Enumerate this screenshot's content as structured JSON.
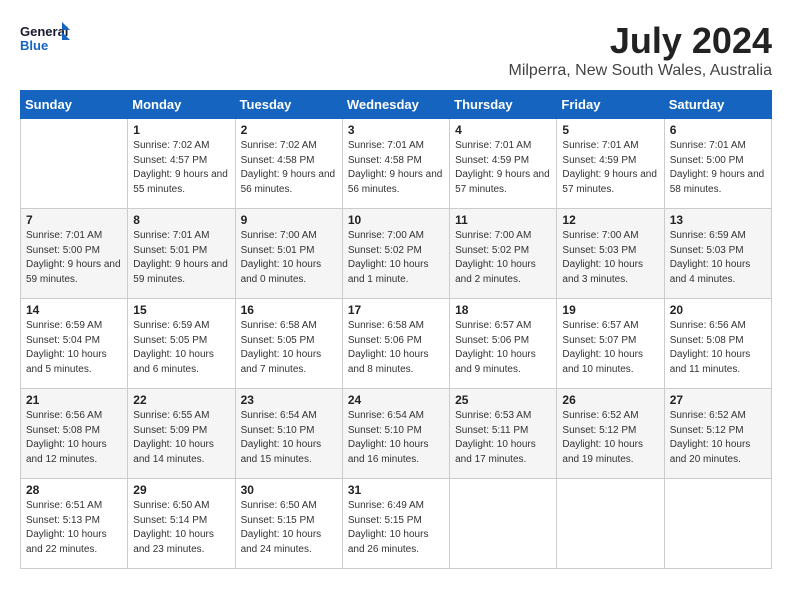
{
  "header": {
    "logo_line1": "General",
    "logo_line2": "Blue",
    "title": "July 2024",
    "subtitle": "Milperra, New South Wales, Australia"
  },
  "days_of_week": [
    "Sunday",
    "Monday",
    "Tuesday",
    "Wednesday",
    "Thursday",
    "Friday",
    "Saturday"
  ],
  "weeks": [
    [
      {
        "day": "",
        "sunrise": "",
        "sunset": "",
        "daylight": ""
      },
      {
        "day": "1",
        "sunrise": "7:02 AM",
        "sunset": "4:57 PM",
        "daylight": "9 hours and 55 minutes."
      },
      {
        "day": "2",
        "sunrise": "7:02 AM",
        "sunset": "4:58 PM",
        "daylight": "9 hours and 56 minutes."
      },
      {
        "day": "3",
        "sunrise": "7:01 AM",
        "sunset": "4:58 PM",
        "daylight": "9 hours and 56 minutes."
      },
      {
        "day": "4",
        "sunrise": "7:01 AM",
        "sunset": "4:59 PM",
        "daylight": "9 hours and 57 minutes."
      },
      {
        "day": "5",
        "sunrise": "7:01 AM",
        "sunset": "4:59 PM",
        "daylight": "9 hours and 57 minutes."
      },
      {
        "day": "6",
        "sunrise": "7:01 AM",
        "sunset": "5:00 PM",
        "daylight": "9 hours and 58 minutes."
      }
    ],
    [
      {
        "day": "7",
        "sunrise": "7:01 AM",
        "sunset": "5:00 PM",
        "daylight": "9 hours and 59 minutes."
      },
      {
        "day": "8",
        "sunrise": "7:01 AM",
        "sunset": "5:01 PM",
        "daylight": "9 hours and 59 minutes."
      },
      {
        "day": "9",
        "sunrise": "7:00 AM",
        "sunset": "5:01 PM",
        "daylight": "10 hours and 0 minutes."
      },
      {
        "day": "10",
        "sunrise": "7:00 AM",
        "sunset": "5:02 PM",
        "daylight": "10 hours and 1 minute."
      },
      {
        "day": "11",
        "sunrise": "7:00 AM",
        "sunset": "5:02 PM",
        "daylight": "10 hours and 2 minutes."
      },
      {
        "day": "12",
        "sunrise": "7:00 AM",
        "sunset": "5:03 PM",
        "daylight": "10 hours and 3 minutes."
      },
      {
        "day": "13",
        "sunrise": "6:59 AM",
        "sunset": "5:03 PM",
        "daylight": "10 hours and 4 minutes."
      }
    ],
    [
      {
        "day": "14",
        "sunrise": "6:59 AM",
        "sunset": "5:04 PM",
        "daylight": "10 hours and 5 minutes."
      },
      {
        "day": "15",
        "sunrise": "6:59 AM",
        "sunset": "5:05 PM",
        "daylight": "10 hours and 6 minutes."
      },
      {
        "day": "16",
        "sunrise": "6:58 AM",
        "sunset": "5:05 PM",
        "daylight": "10 hours and 7 minutes."
      },
      {
        "day": "17",
        "sunrise": "6:58 AM",
        "sunset": "5:06 PM",
        "daylight": "10 hours and 8 minutes."
      },
      {
        "day": "18",
        "sunrise": "6:57 AM",
        "sunset": "5:06 PM",
        "daylight": "10 hours and 9 minutes."
      },
      {
        "day": "19",
        "sunrise": "6:57 AM",
        "sunset": "5:07 PM",
        "daylight": "10 hours and 10 minutes."
      },
      {
        "day": "20",
        "sunrise": "6:56 AM",
        "sunset": "5:08 PM",
        "daylight": "10 hours and 11 minutes."
      }
    ],
    [
      {
        "day": "21",
        "sunrise": "6:56 AM",
        "sunset": "5:08 PM",
        "daylight": "10 hours and 12 minutes."
      },
      {
        "day": "22",
        "sunrise": "6:55 AM",
        "sunset": "5:09 PM",
        "daylight": "10 hours and 14 minutes."
      },
      {
        "day": "23",
        "sunrise": "6:54 AM",
        "sunset": "5:10 PM",
        "daylight": "10 hours and 15 minutes."
      },
      {
        "day": "24",
        "sunrise": "6:54 AM",
        "sunset": "5:10 PM",
        "daylight": "10 hours and 16 minutes."
      },
      {
        "day": "25",
        "sunrise": "6:53 AM",
        "sunset": "5:11 PM",
        "daylight": "10 hours and 17 minutes."
      },
      {
        "day": "26",
        "sunrise": "6:52 AM",
        "sunset": "5:12 PM",
        "daylight": "10 hours and 19 minutes."
      },
      {
        "day": "27",
        "sunrise": "6:52 AM",
        "sunset": "5:12 PM",
        "daylight": "10 hours and 20 minutes."
      }
    ],
    [
      {
        "day": "28",
        "sunrise": "6:51 AM",
        "sunset": "5:13 PM",
        "daylight": "10 hours and 22 minutes."
      },
      {
        "day": "29",
        "sunrise": "6:50 AM",
        "sunset": "5:14 PM",
        "daylight": "10 hours and 23 minutes."
      },
      {
        "day": "30",
        "sunrise": "6:50 AM",
        "sunset": "5:15 PM",
        "daylight": "10 hours and 24 minutes."
      },
      {
        "day": "31",
        "sunrise": "6:49 AM",
        "sunset": "5:15 PM",
        "daylight": "10 hours and 26 minutes."
      },
      {
        "day": "",
        "sunrise": "",
        "sunset": "",
        "daylight": ""
      },
      {
        "day": "",
        "sunrise": "",
        "sunset": "",
        "daylight": ""
      },
      {
        "day": "",
        "sunrise": "",
        "sunset": "",
        "daylight": ""
      }
    ]
  ]
}
